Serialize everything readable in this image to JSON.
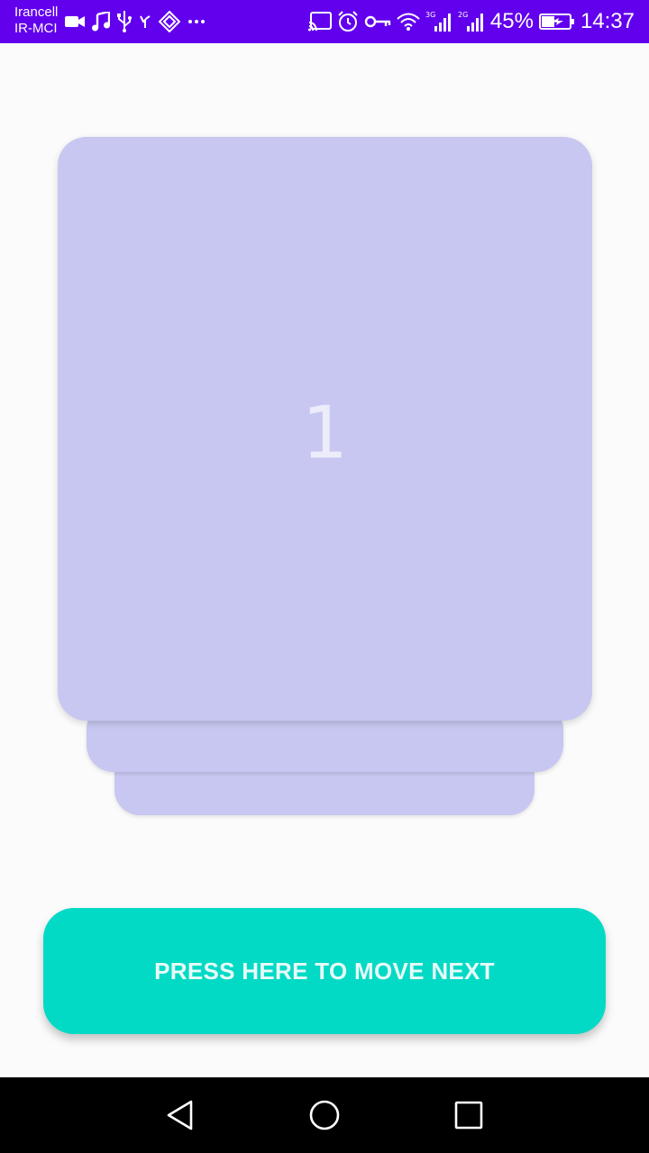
{
  "status_bar": {
    "carrier_line1": "Irancell",
    "carrier_line2": "IR-MCI",
    "left_icons": [
      "video-camera-icon",
      "music-note-icon",
      "usb-icon",
      "persian-digit-2-icon",
      "diamond-app-icon",
      "more-dots-icon"
    ],
    "right_icons": [
      "cast-icon",
      "alarm-icon",
      "key-icon",
      "wifi-icon",
      "signal-3g-icon",
      "signal-2g-icon"
    ],
    "battery_percent": "45%",
    "time": "14:37",
    "background_color": "#6200ee"
  },
  "cards": {
    "front_number": "1",
    "card_color": "#c7c7f1",
    "stack_count": 3
  },
  "next_button": {
    "label": "PRESS HERE TO MOVE NEXT",
    "color": "#03dac5"
  },
  "navigation_bar": {
    "buttons": [
      "back-icon",
      "home-icon",
      "recents-icon"
    ]
  }
}
